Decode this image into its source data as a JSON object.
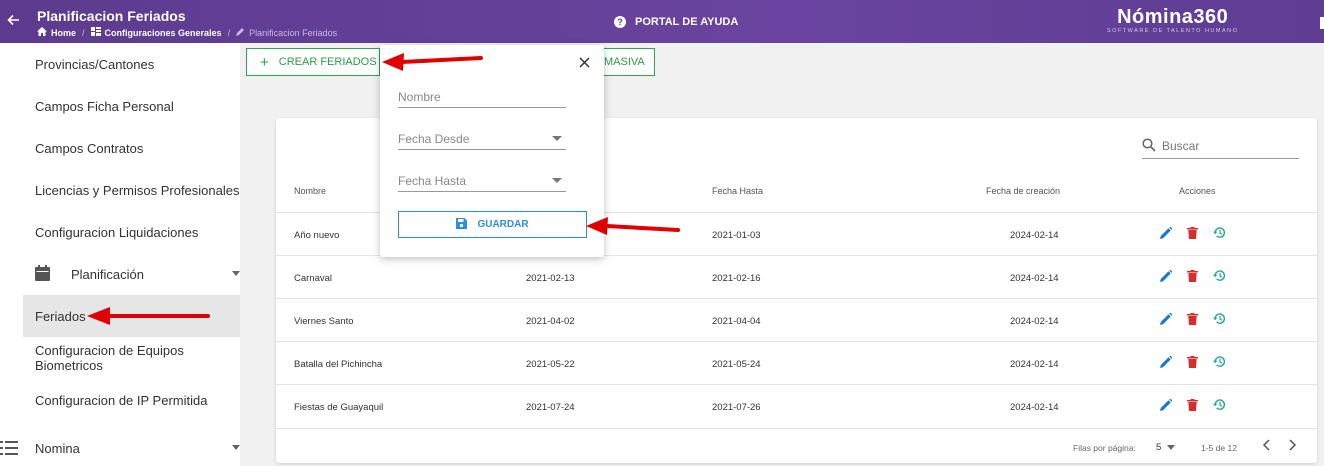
{
  "header": {
    "title": "Planificacion Feriados",
    "breadcrumbs": [
      {
        "label": "Home"
      },
      {
        "label": "Configuraciones Generales"
      },
      {
        "label": "Planificacion Feriados"
      }
    ],
    "help_label": "PORTAL DE AYUDA",
    "brand_name": "Nómina360",
    "brand_tagline": "SOFTWARE DE TALENTO HUMANO"
  },
  "sidebar": {
    "items": [
      {
        "label": "Provincias/Cantones"
      },
      {
        "label": "Campos Ficha Personal"
      },
      {
        "label": "Campos Contratos"
      },
      {
        "label": "Licencias y Permisos Profesionales"
      },
      {
        "label": "Configuracion Liquidaciones"
      }
    ],
    "group_planificacion": "Planificación",
    "sub_items": [
      {
        "label": "Feriados"
      },
      {
        "label": "Configuracion de Equipos Biometricos"
      },
      {
        "label": "Configuracion de IP Permitida"
      }
    ],
    "group_nomina": "Nomina"
  },
  "toolbar": {
    "crear_label": "CREAR FERIADOS",
    "masiva_label": "MASIVA"
  },
  "form": {
    "nombre_placeholder": "Nombre",
    "desde_placeholder": "Fecha Desde",
    "hasta_placeholder": "Fecha Hasta",
    "guardar_label": "GUARDAR"
  },
  "table": {
    "search_placeholder": "Buscar",
    "headers": {
      "nombre": "Nombre",
      "hasta": "Fecha Hasta",
      "creacion": "Fecha de creación",
      "acciones": "Acciones"
    },
    "rows": [
      {
        "nombre": "Año nuevo",
        "desde": "",
        "hasta": "2021-01-03",
        "creacion": "2024-02-14"
      },
      {
        "nombre": "Carnaval",
        "desde": "2021-02-13",
        "hasta": "2021-02-16",
        "creacion": "2024-02-14"
      },
      {
        "nombre": "Viernes Santo",
        "desde": "2021-04-02",
        "hasta": "2021-04-04",
        "creacion": "2024-02-14"
      },
      {
        "nombre": "Batalla del Pichincha",
        "desde": "2021-05-22",
        "hasta": "2021-05-24",
        "creacion": "2024-02-14"
      },
      {
        "nombre": "Fiestas de Guayaquil",
        "desde": "2021-07-24",
        "hasta": "2021-07-26",
        "creacion": "2024-02-14"
      }
    ],
    "footer": {
      "rows_per_page_label": "Filas por página:",
      "rows_per_page": "5",
      "range": "1-5 de 12"
    }
  },
  "colors": {
    "header_purple": "#5e3d92",
    "action_green": "#2e9a4a",
    "edit_blue": "#1976d2",
    "delete_red": "#d32f2f",
    "history_teal": "#26a69a",
    "annotation_red": "#e00000"
  }
}
